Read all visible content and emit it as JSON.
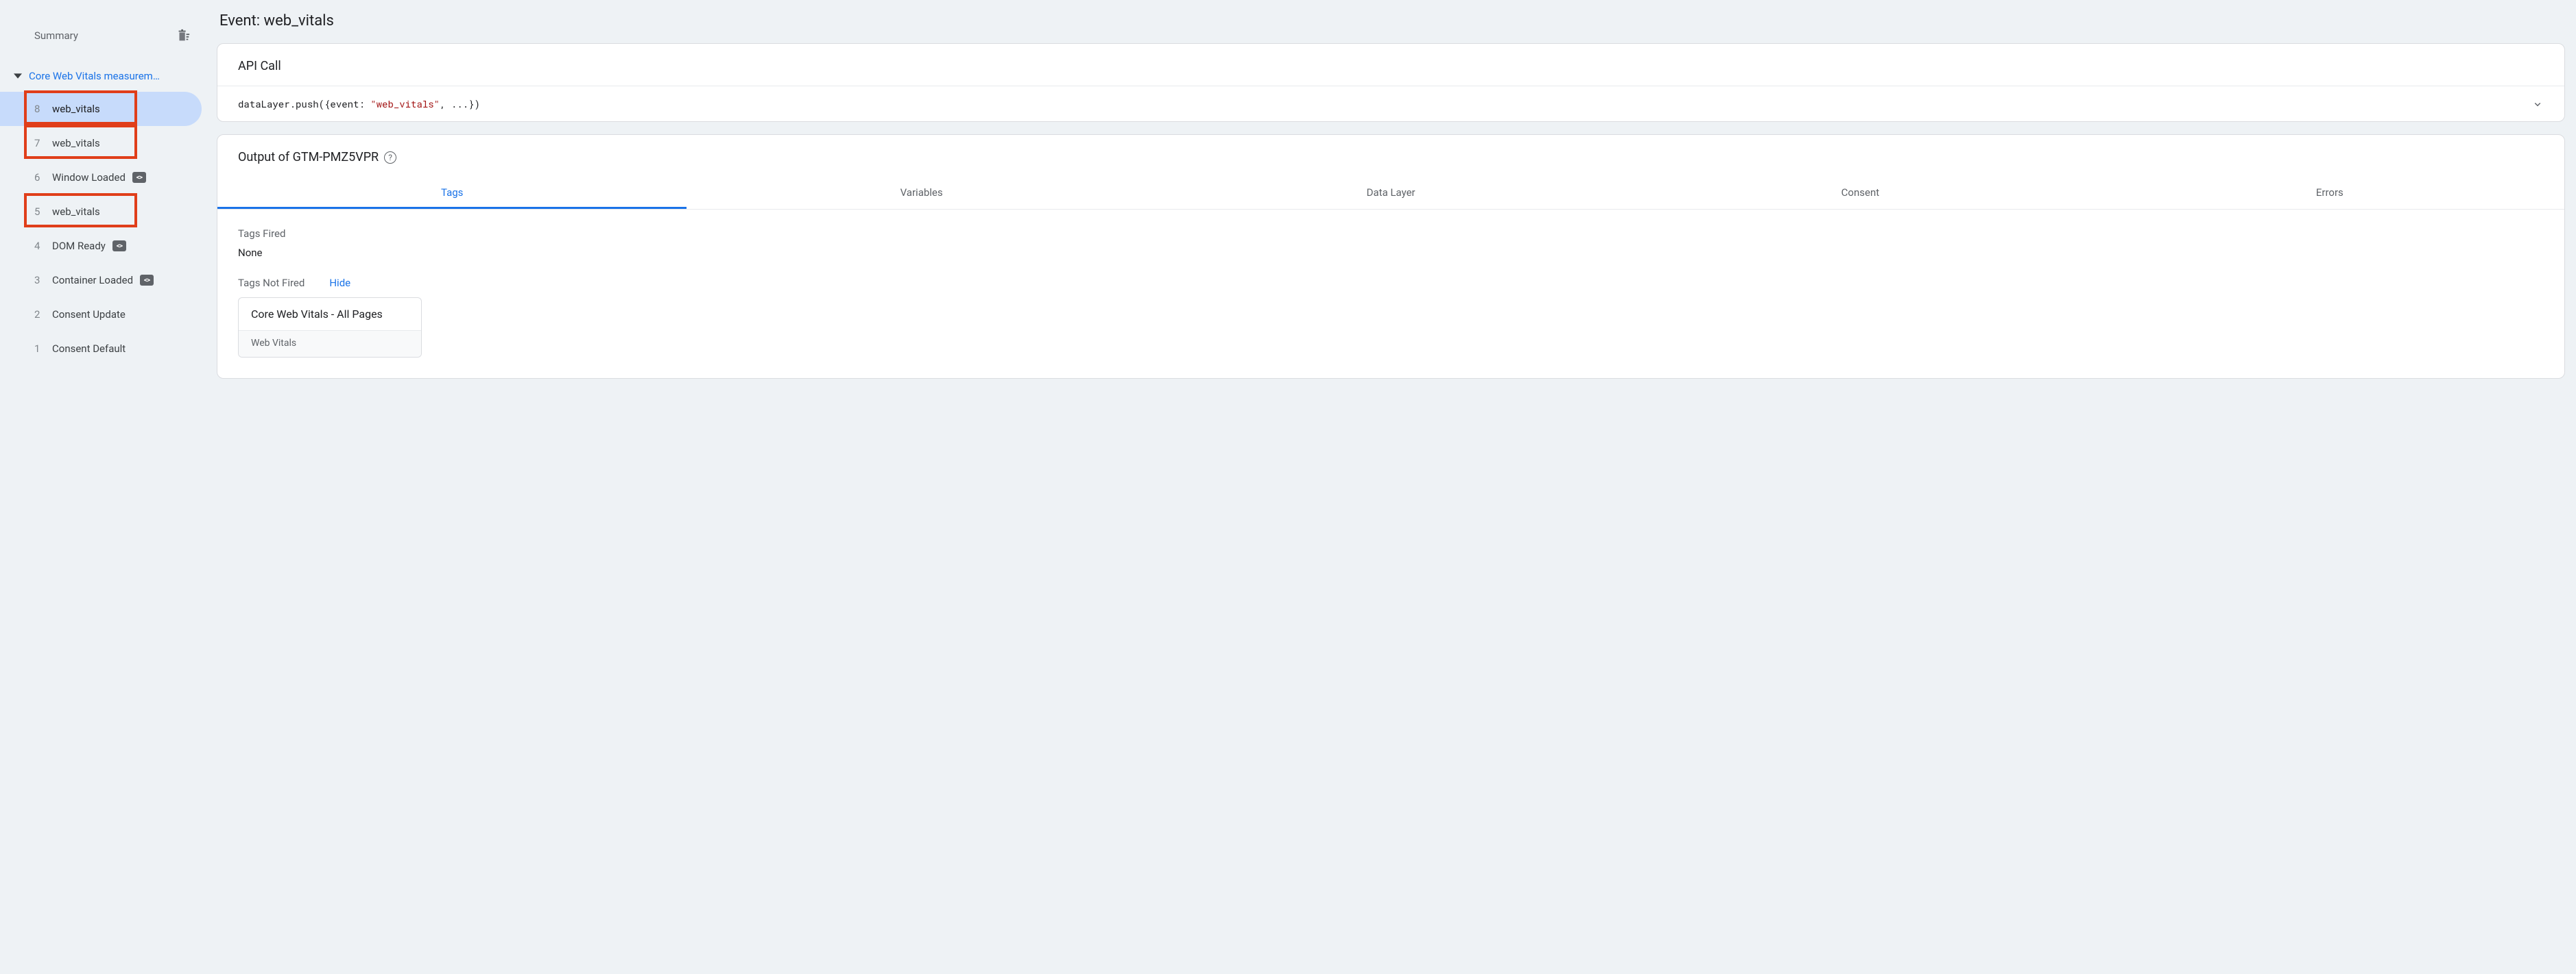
{
  "sidebar": {
    "summary_label": "Summary",
    "session_title": "Core Web Vitals measurem…",
    "events": [
      {
        "num": "8",
        "name": "web_vitals",
        "selected": true,
        "hasCodeBadge": false,
        "highlighted": true
      },
      {
        "num": "7",
        "name": "web_vitals",
        "selected": false,
        "hasCodeBadge": false,
        "highlighted": true
      },
      {
        "num": "6",
        "name": "Window Loaded",
        "selected": false,
        "hasCodeBadge": true,
        "highlighted": false
      },
      {
        "num": "5",
        "name": "web_vitals",
        "selected": false,
        "hasCodeBadge": false,
        "highlighted": true
      },
      {
        "num": "4",
        "name": "DOM Ready",
        "selected": false,
        "hasCodeBadge": true,
        "highlighted": false
      },
      {
        "num": "3",
        "name": "Container Loaded",
        "selected": false,
        "hasCodeBadge": true,
        "highlighted": false
      },
      {
        "num": "2",
        "name": "Consent Update",
        "selected": false,
        "hasCodeBadge": false,
        "highlighted": false
      },
      {
        "num": "1",
        "name": "Consent Default",
        "selected": false,
        "hasCodeBadge": false,
        "highlighted": false
      }
    ]
  },
  "main": {
    "event_title": "Event: web_vitals",
    "api_call": {
      "header": "API Call",
      "code_pre": "dataLayer.push({event: ",
      "code_str": "\"web_vitals\"",
      "code_post": ", ...})"
    },
    "output": {
      "header": "Output of GTM-PMZ5VPR",
      "tabs": [
        "Tags",
        "Variables",
        "Data Layer",
        "Consent",
        "Errors"
      ],
      "active_tab": 0,
      "tags_fired_label": "Tags Fired",
      "tags_fired_value": "None",
      "tags_not_fired_label": "Tags Not Fired",
      "hide_label": "Hide",
      "not_fired_tag": {
        "title": "Core Web Vitals - All Pages",
        "type": "Web Vitals"
      }
    }
  }
}
